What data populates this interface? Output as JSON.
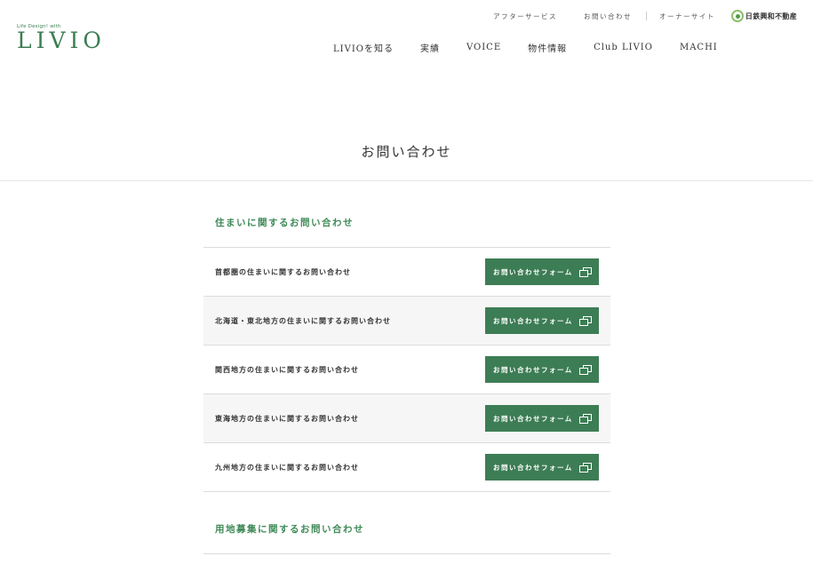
{
  "logo": {
    "tagline": "Life Design! with",
    "wordmark": "LIVIO"
  },
  "utility_nav": {
    "after_service": "アフターサービス",
    "contact": "お問い合わせ",
    "owner_site": "オーナーサイト",
    "company": "日鉄興和不動産"
  },
  "global_nav": {
    "items": [
      {
        "label": "LIVIOを知る"
      },
      {
        "label": "実績"
      },
      {
        "label": "VOICE"
      },
      {
        "label": "物件情報"
      },
      {
        "label": "Club LIVIO"
      },
      {
        "label": "MACHI"
      }
    ]
  },
  "page": {
    "title": "お問い合わせ"
  },
  "sections": [
    {
      "heading": "住まいに関するお問い合わせ",
      "rows": [
        {
          "label": "首都圏の住まいに関するお問い合わせ",
          "button": "お問い合わせフォーム"
        },
        {
          "label": "北海道・東北地方の住まいに関するお問い合わせ",
          "button": "お問い合わせフォーム"
        },
        {
          "label": "関西地方の住まいに関するお問い合わせ",
          "button": "お問い合わせフォーム"
        },
        {
          "label": "東海地方の住まいに関するお問い合わせ",
          "button": "お問い合わせフォーム"
        },
        {
          "label": "九州地方の住まいに関するお問い合わせ",
          "button": "お問い合わせフォーム"
        }
      ]
    },
    {
      "heading": "用地募集に関するお問い合わせ"
    }
  ],
  "colors": {
    "brand_green": "#3b7d52",
    "button_green": "#3d7d55",
    "heading_green": "#3f8a58",
    "row_alt_bg": "#f6f6f6"
  },
  "icons": {
    "external_window": "external-window-icon",
    "company_logo": "nippon-steel-kowa-logo-icon"
  }
}
